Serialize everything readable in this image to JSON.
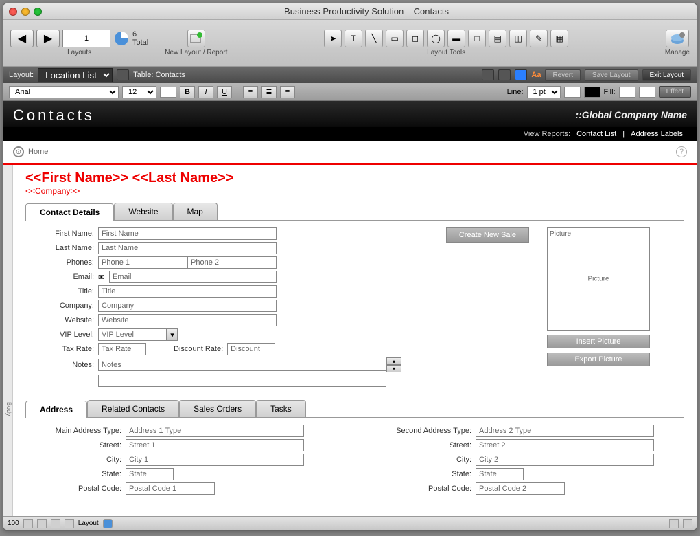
{
  "window_title": "Business Productivity Solution – Contacts",
  "toolbar": {
    "record": "1",
    "total_count": "6",
    "total_label": "Total",
    "groups": {
      "layouts": "Layouts",
      "new_layout": "New Layout / Report",
      "layout_tools": "Layout Tools",
      "manage": "Manage"
    }
  },
  "layoutbar": {
    "layout_label": "Layout:",
    "layout_value": "Location List",
    "table_label": "Table: Contacts",
    "aa": "Aa",
    "revert": "Revert",
    "save": "Save Layout",
    "exit": "Exit Layout"
  },
  "fmtbar": {
    "font": "Arial",
    "size": "12",
    "line_lbl": "Line:",
    "line_val": "1 pt",
    "fill_lbl": "Fill:",
    "effect": "Effect"
  },
  "header": {
    "title": "Contacts",
    "global": "::Global Company Name",
    "reports_lbl": "View Reports:",
    "contact_list": "Contact List",
    "address_labels": "Address Labels"
  },
  "home": "Home",
  "merge": {
    "name": "<<First Name>> <<Last Name>>",
    "company": "<<Company>>"
  },
  "tabs1": [
    "Contact Details",
    "Website",
    "Map"
  ],
  "fields": {
    "first_name_lbl": "First Name:",
    "first_name": "First Name",
    "last_name_lbl": "Last Name:",
    "last_name": "Last Name",
    "phones_lbl": "Phones:",
    "phone1": "Phone 1",
    "phone2": "Phone 2",
    "email_lbl": "Email:",
    "email": "Email",
    "title_lbl": "Title:",
    "title": "Title",
    "company_lbl": "Company:",
    "company": "Company",
    "website_lbl": "Website:",
    "website": "Website",
    "vip_lbl": "VIP Level:",
    "vip": "VIP Level",
    "tax_lbl": "Tax Rate:",
    "tax": "Tax Rate",
    "disc_lbl": "Discount Rate:",
    "disc": "Discount",
    "notes_lbl": "Notes:",
    "notes": "Notes"
  },
  "buttons": {
    "create_sale": "Create New Sale",
    "insert_pic": "Insert Picture",
    "export_pic": "Export Picture"
  },
  "picture": {
    "top": "Picture",
    "center": "Picture"
  },
  "tabs2": [
    "Address",
    "Related Contacts",
    "Sales Orders",
    "Tasks"
  ],
  "addr": {
    "main_type_lbl": "Main Address Type:",
    "main_type": "Address 1 Type",
    "second_type_lbl": "Second Address Type:",
    "second_type": "Address 2 Type",
    "street_lbl": "Street:",
    "street1": "Street 1",
    "street2": "Street 2",
    "city_lbl": "City:",
    "city1": "City 1",
    "city2": "City 2",
    "state_lbl": "State:",
    "state1": "State",
    "state2": "State",
    "postal_lbl": "Postal Code:",
    "postal1": "Postal Code 1",
    "postal2": "Postal Code 2"
  },
  "status": {
    "zoom": "100",
    "mode": "Layout"
  },
  "side": "Body"
}
